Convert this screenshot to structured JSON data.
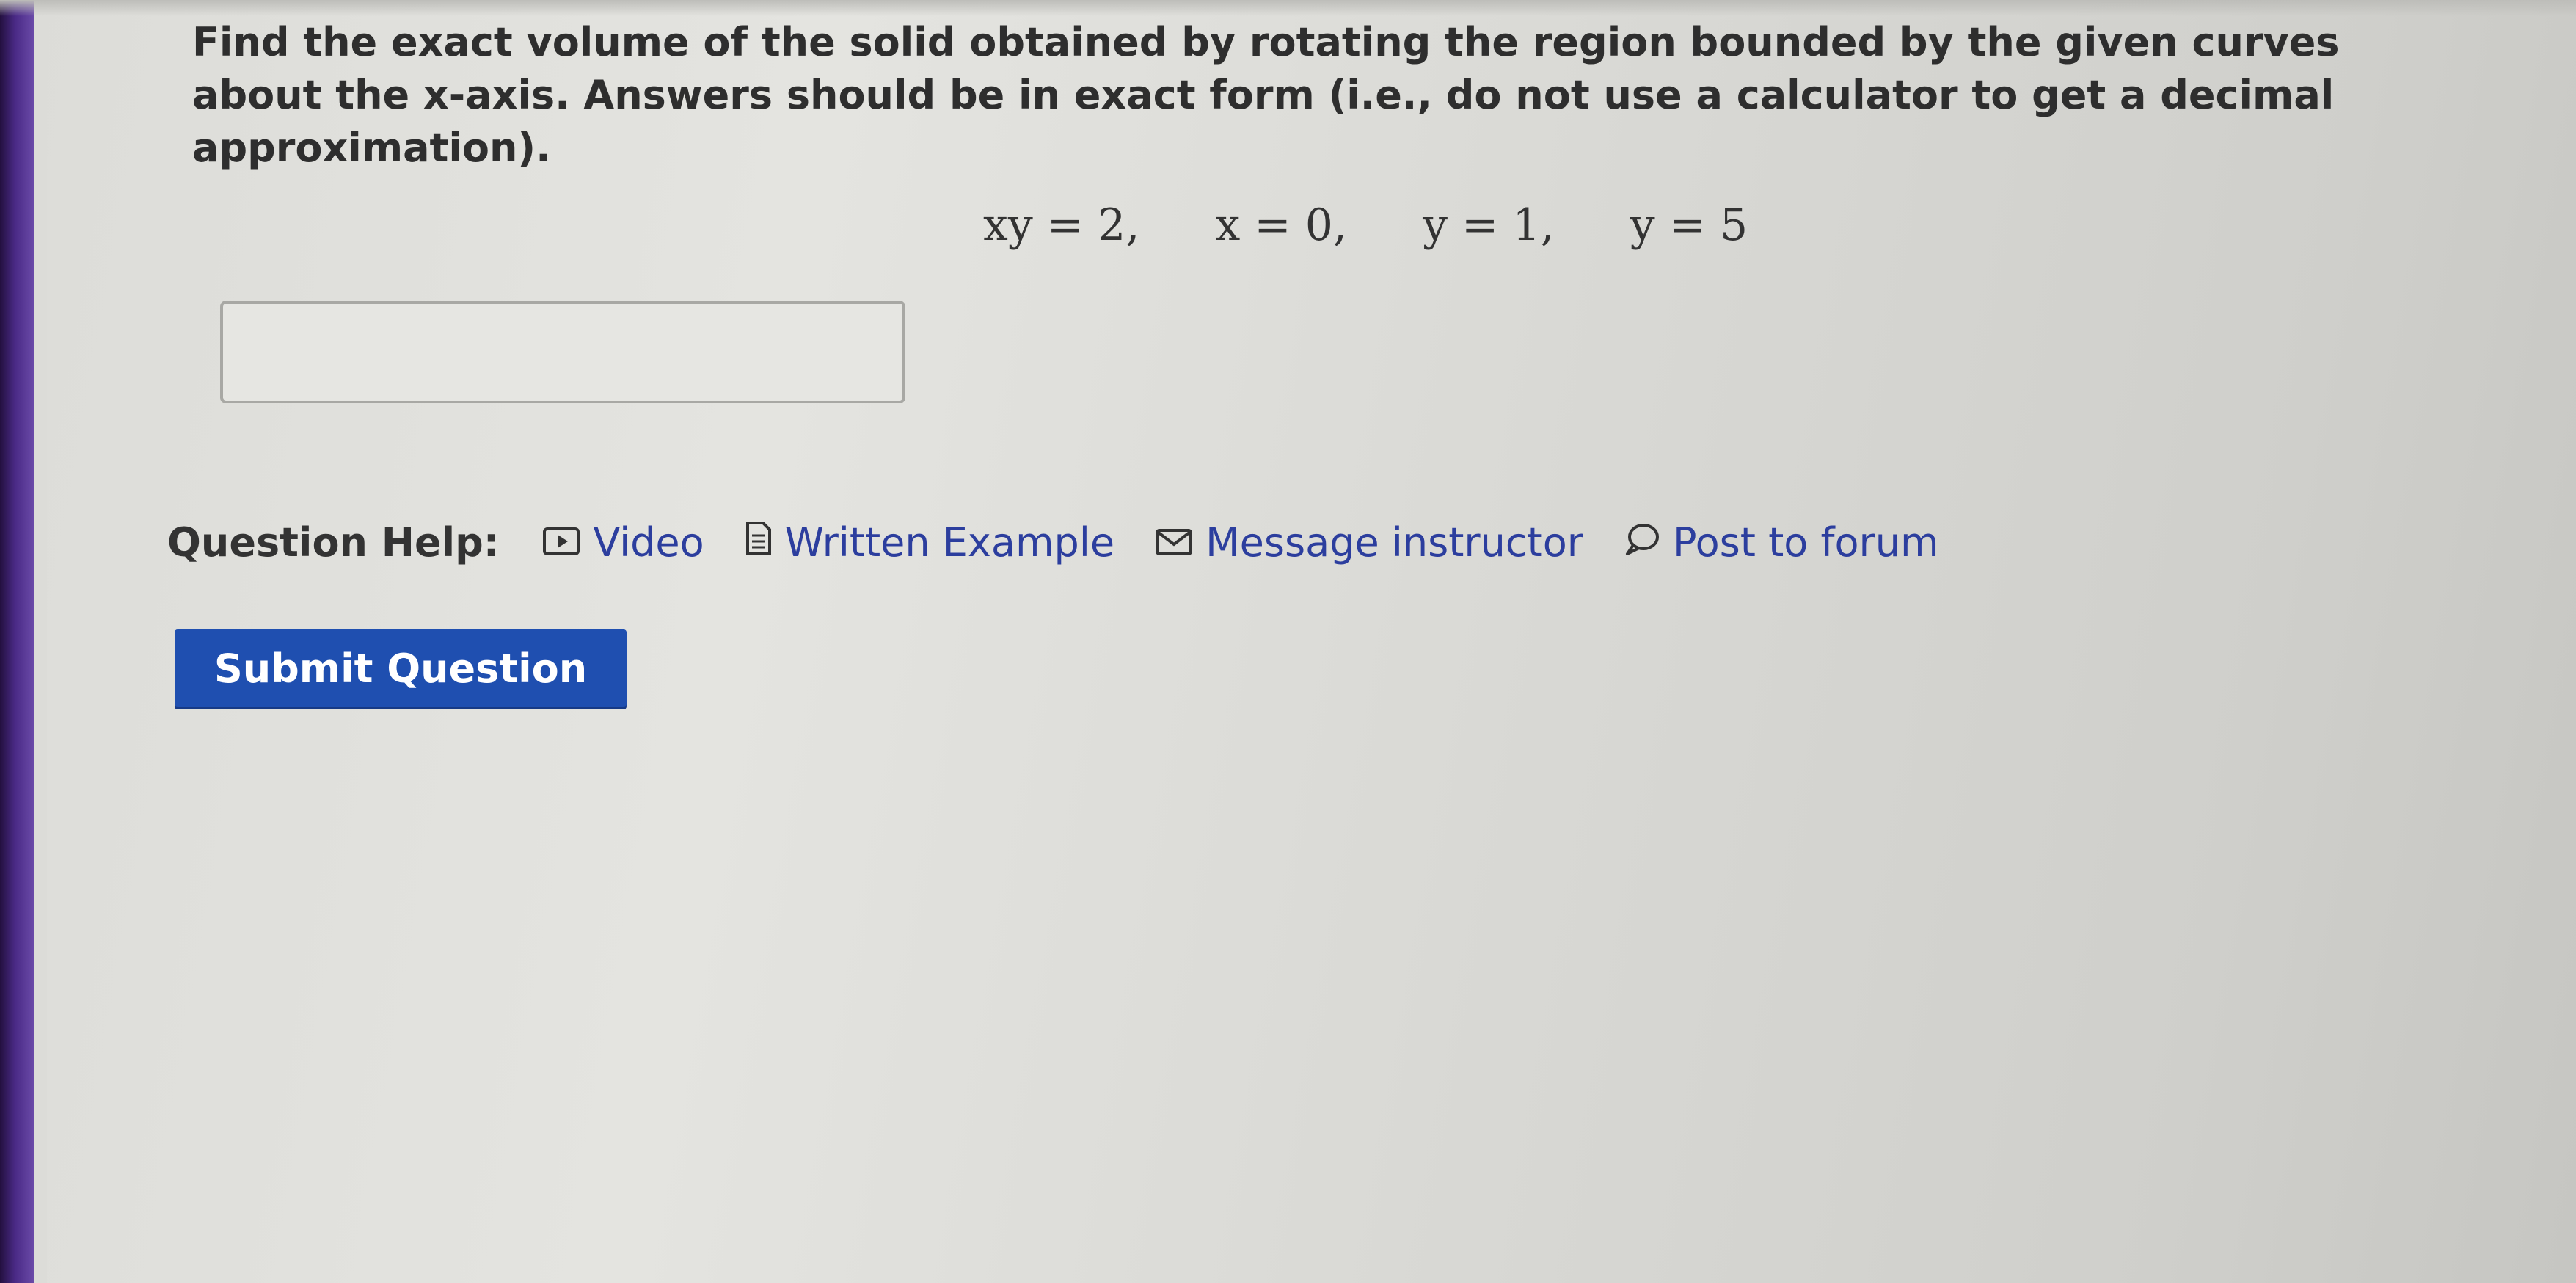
{
  "question": {
    "text": "Find the exact volume of the solid obtained by rotating the region bounded by the given curves about the x-axis. Answers should be in exact form (i.e., do not use a calculator to get a decimal approximation).",
    "equations": [
      "xy = 2,",
      "x = 0,",
      "y = 1,",
      "y = 5"
    ]
  },
  "answer": {
    "value": "",
    "placeholder": ""
  },
  "help": {
    "label": "Question Help:",
    "links": [
      {
        "label": "Video",
        "icon": "video-icon"
      },
      {
        "label": "Written Example",
        "icon": "document-icon"
      },
      {
        "label": "Message instructor",
        "icon": "mail-icon"
      },
      {
        "label": "Post to forum",
        "icon": "speech-bubble-icon"
      }
    ]
  },
  "submit": {
    "label": "Submit Question"
  },
  "colors": {
    "accent": "#1f4fb0",
    "link": "#2c3e9e",
    "sidebar": "#4a2a86"
  }
}
